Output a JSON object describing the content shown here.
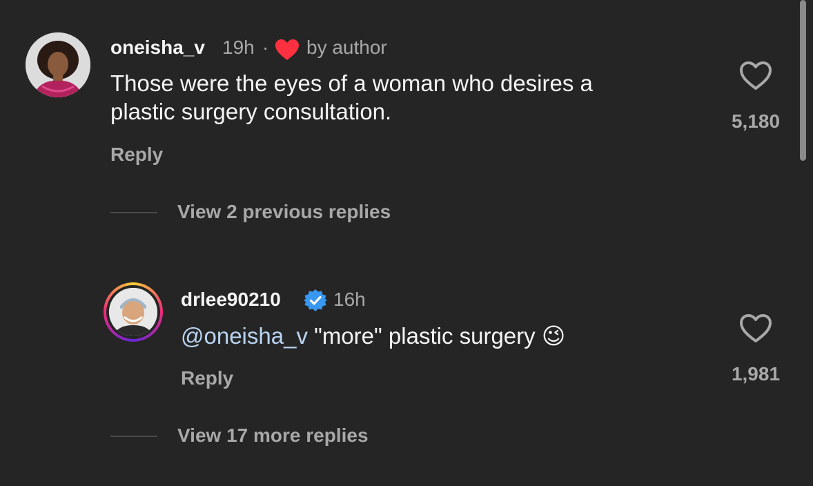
{
  "comments": [
    {
      "username": "oneisha_v",
      "time": "19h",
      "separator": "·",
      "liked_by_author_label": "by author",
      "text_line1": "Those were the eyes of a woman who desires a",
      "text_line2": "plastic surgery consultation.",
      "reply_label": "Reply",
      "like_count": "5,180",
      "view_replies_label": "View 2 previous replies"
    },
    {
      "username": "drlee90210",
      "verified": true,
      "time": "16h",
      "mention": "@oneisha_v",
      "text": " \"more\" plastic surgery ",
      "emoji": "😉",
      "reply_label": "Reply",
      "like_count": "1,981",
      "view_replies_label": "View 17 more replies"
    }
  ],
  "colors": {
    "background": "#252525",
    "primary_text": "#f5f5f5",
    "secondary_text": "#a8a8a8",
    "heart_red": "#ff3040",
    "verified_blue": "#3897f0"
  }
}
